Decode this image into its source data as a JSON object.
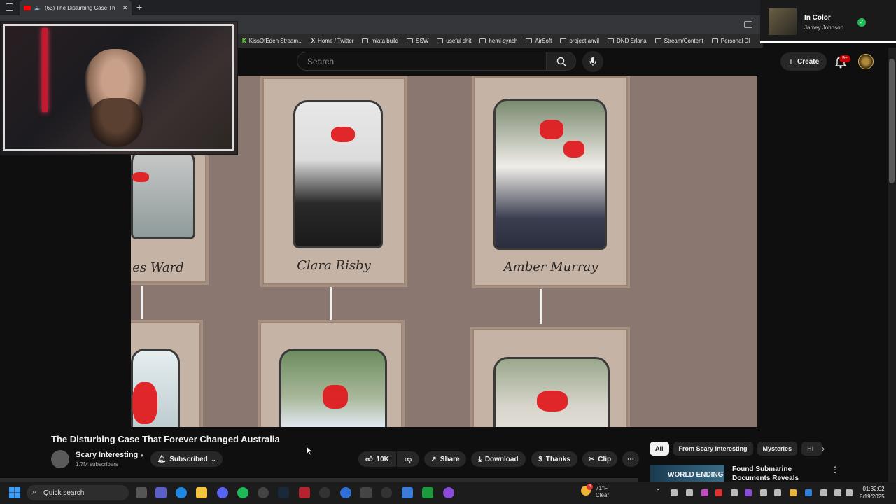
{
  "browser": {
    "tab_title": "(63) The Disturbing Case Th",
    "bookmarks": [
      "KissOfEden Stream...",
      "Home / Twitter",
      "miata build",
      "SSW",
      "useful shit",
      "hemi-synch",
      "AirSoft",
      "project anvil",
      "DND Erlana",
      "Stream/Content",
      "Personal Dl"
    ]
  },
  "now_playing": {
    "title": "In Color",
    "artist": "Jamey Johnson"
  },
  "youtube": {
    "search_placeholder": "Search",
    "create_label": "Create",
    "notification_badge": "9+"
  },
  "video": {
    "cards": [
      {
        "name": "es Ward"
      },
      {
        "name": "Clara Risby"
      },
      {
        "name": "Amber Murray"
      }
    ],
    "title": "The Disturbing Case That Forever Changed Australia",
    "channel": "Scary Interesting",
    "subscribers": "1.7M subscribers",
    "subscribed_label": "Subscribed",
    "likes": "10K",
    "share_label": "Share",
    "download_label": "Download",
    "thanks_label": "Thanks",
    "clip_label": "Clip"
  },
  "chips": [
    "All",
    "From Scary Interesting",
    "Mysteries",
    "Hi"
  ],
  "recommendation": {
    "thumb_text": "WORLD ENDING",
    "title": "Found Submarine Documents Reveals Horrifying Story"
  },
  "taskbar": {
    "search_label": "Quick search",
    "weather_temp": "71°F",
    "weather_cond": "Clear",
    "weather_badge": "4",
    "time": "01:32:02",
    "date": "8/19/2025"
  },
  "colors": {
    "accent": "#ff0000",
    "redaction": "#e01c20",
    "card": "#c5b3a5"
  }
}
